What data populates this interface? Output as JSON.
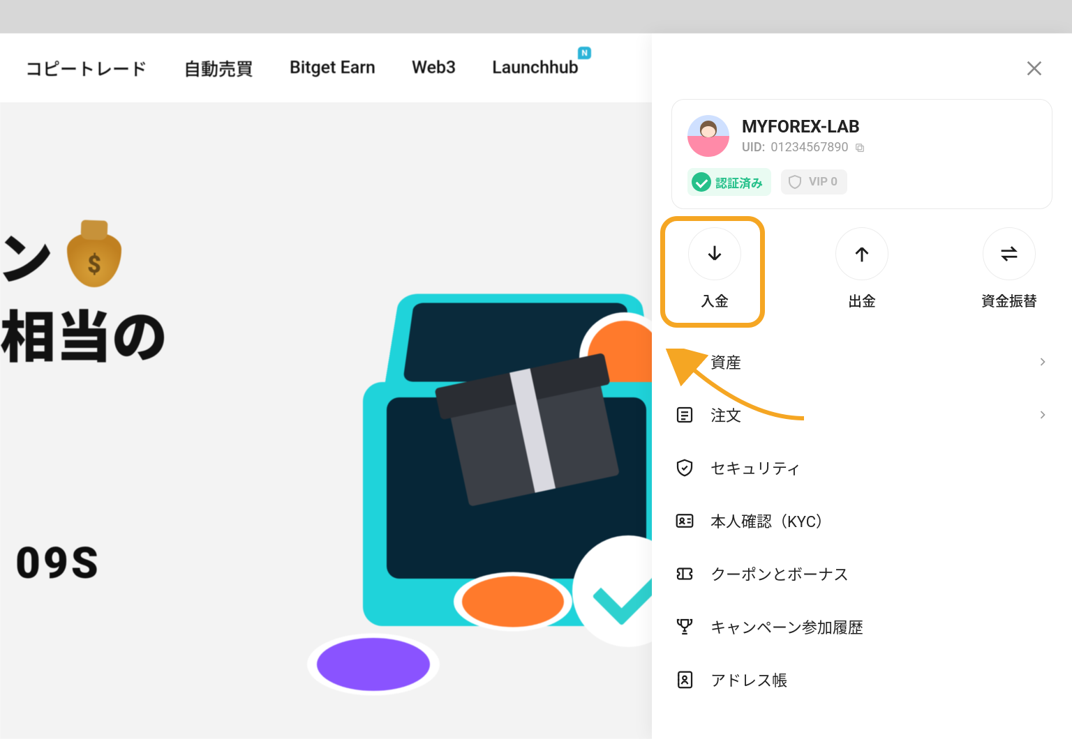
{
  "nav": {
    "items": [
      {
        "label": "コピートレード"
      },
      {
        "label": "自動売買"
      },
      {
        "label": "Bitget Earn"
      },
      {
        "label": "Web3"
      },
      {
        "label": "Launchhub",
        "badge": "N"
      }
    ]
  },
  "hero": {
    "line1": "ペーン",
    "line2": "万円相当の",
    "timer": "09S"
  },
  "user": {
    "name": "MYFOREX-LAB",
    "uid_label": "UID:",
    "uid": "01234567890",
    "verified_label": "認証済み",
    "vip_label": "VIP 0"
  },
  "actions": {
    "deposit": "入金",
    "withdraw": "出金",
    "transfer": "資金振替"
  },
  "menu": {
    "assets": "資産",
    "orders": "注文",
    "security": "セキュリティ",
    "kyc": "本人確認（KYC）",
    "coupons": "クーポンとボーナス",
    "campaign": "キャンペーン参加履歴",
    "addressbook": "アドレス帳"
  }
}
